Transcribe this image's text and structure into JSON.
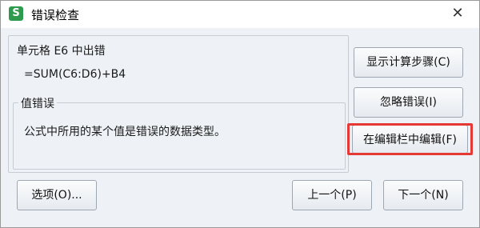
{
  "titlebar": {
    "app_icon_glyph": "S",
    "title": "错误检查",
    "close_glyph": "✕"
  },
  "cell_section": {
    "heading": "单元格 E6 中出错",
    "formula": "=SUM(C6:D6)+B4"
  },
  "error_section": {
    "heading": "值错误",
    "description": "公式中所用的某个值是错误的数据类型。"
  },
  "buttons": {
    "show_steps": "显示计算步骤(C)",
    "ignore_error": "忽略错误(I)",
    "edit_in_bar": "在编辑栏中编辑(F)",
    "options": "选项(O)...",
    "previous": "上一个(P)",
    "next": "下一个(N)"
  },
  "colors": {
    "highlight": "#e53935",
    "app_icon": "#2e9a4e"
  }
}
